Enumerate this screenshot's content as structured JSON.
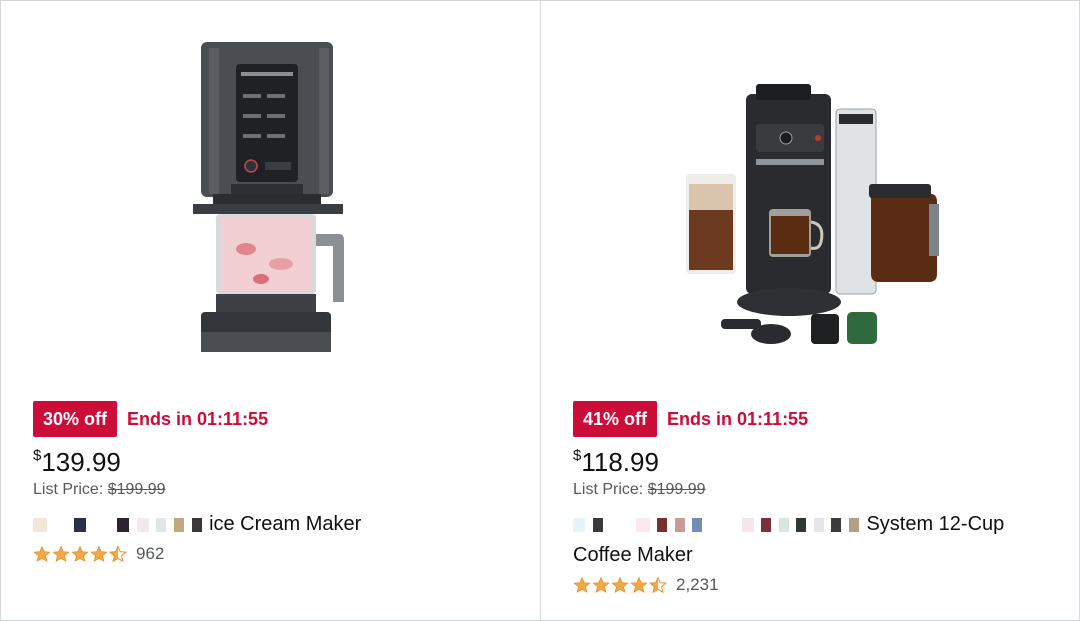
{
  "products": [
    {
      "discount_badge": "30% off",
      "deal_timer": "Ends in 01:11:55",
      "price_symbol": "$",
      "price_value": "139.99",
      "list_price_label": "List Price:",
      "list_price_value": "$199.99",
      "title_visible": "ice Cream Maker",
      "rating_stars": 4.5,
      "review_count": "962",
      "image": "ice-cream-maker-product-image"
    },
    {
      "discount_badge": "41% off",
      "deal_timer": "Ends in 01:11:55",
      "price_symbol": "$",
      "price_value": "118.99",
      "list_price_label": "List Price:",
      "list_price_value": "$199.99",
      "title_visible": "System 12-Cup Coffee Maker",
      "rating_stars": 4.5,
      "review_count": "2,231",
      "image": "coffee-maker-product-image"
    }
  ],
  "colors": {
    "deal_red": "#cc0c39",
    "star_orange": "#f3a847",
    "muted_text": "#565959",
    "border": "#d5d9d9"
  },
  "icons": {
    "star": "star-icon",
    "half_star": "half-star-icon"
  }
}
